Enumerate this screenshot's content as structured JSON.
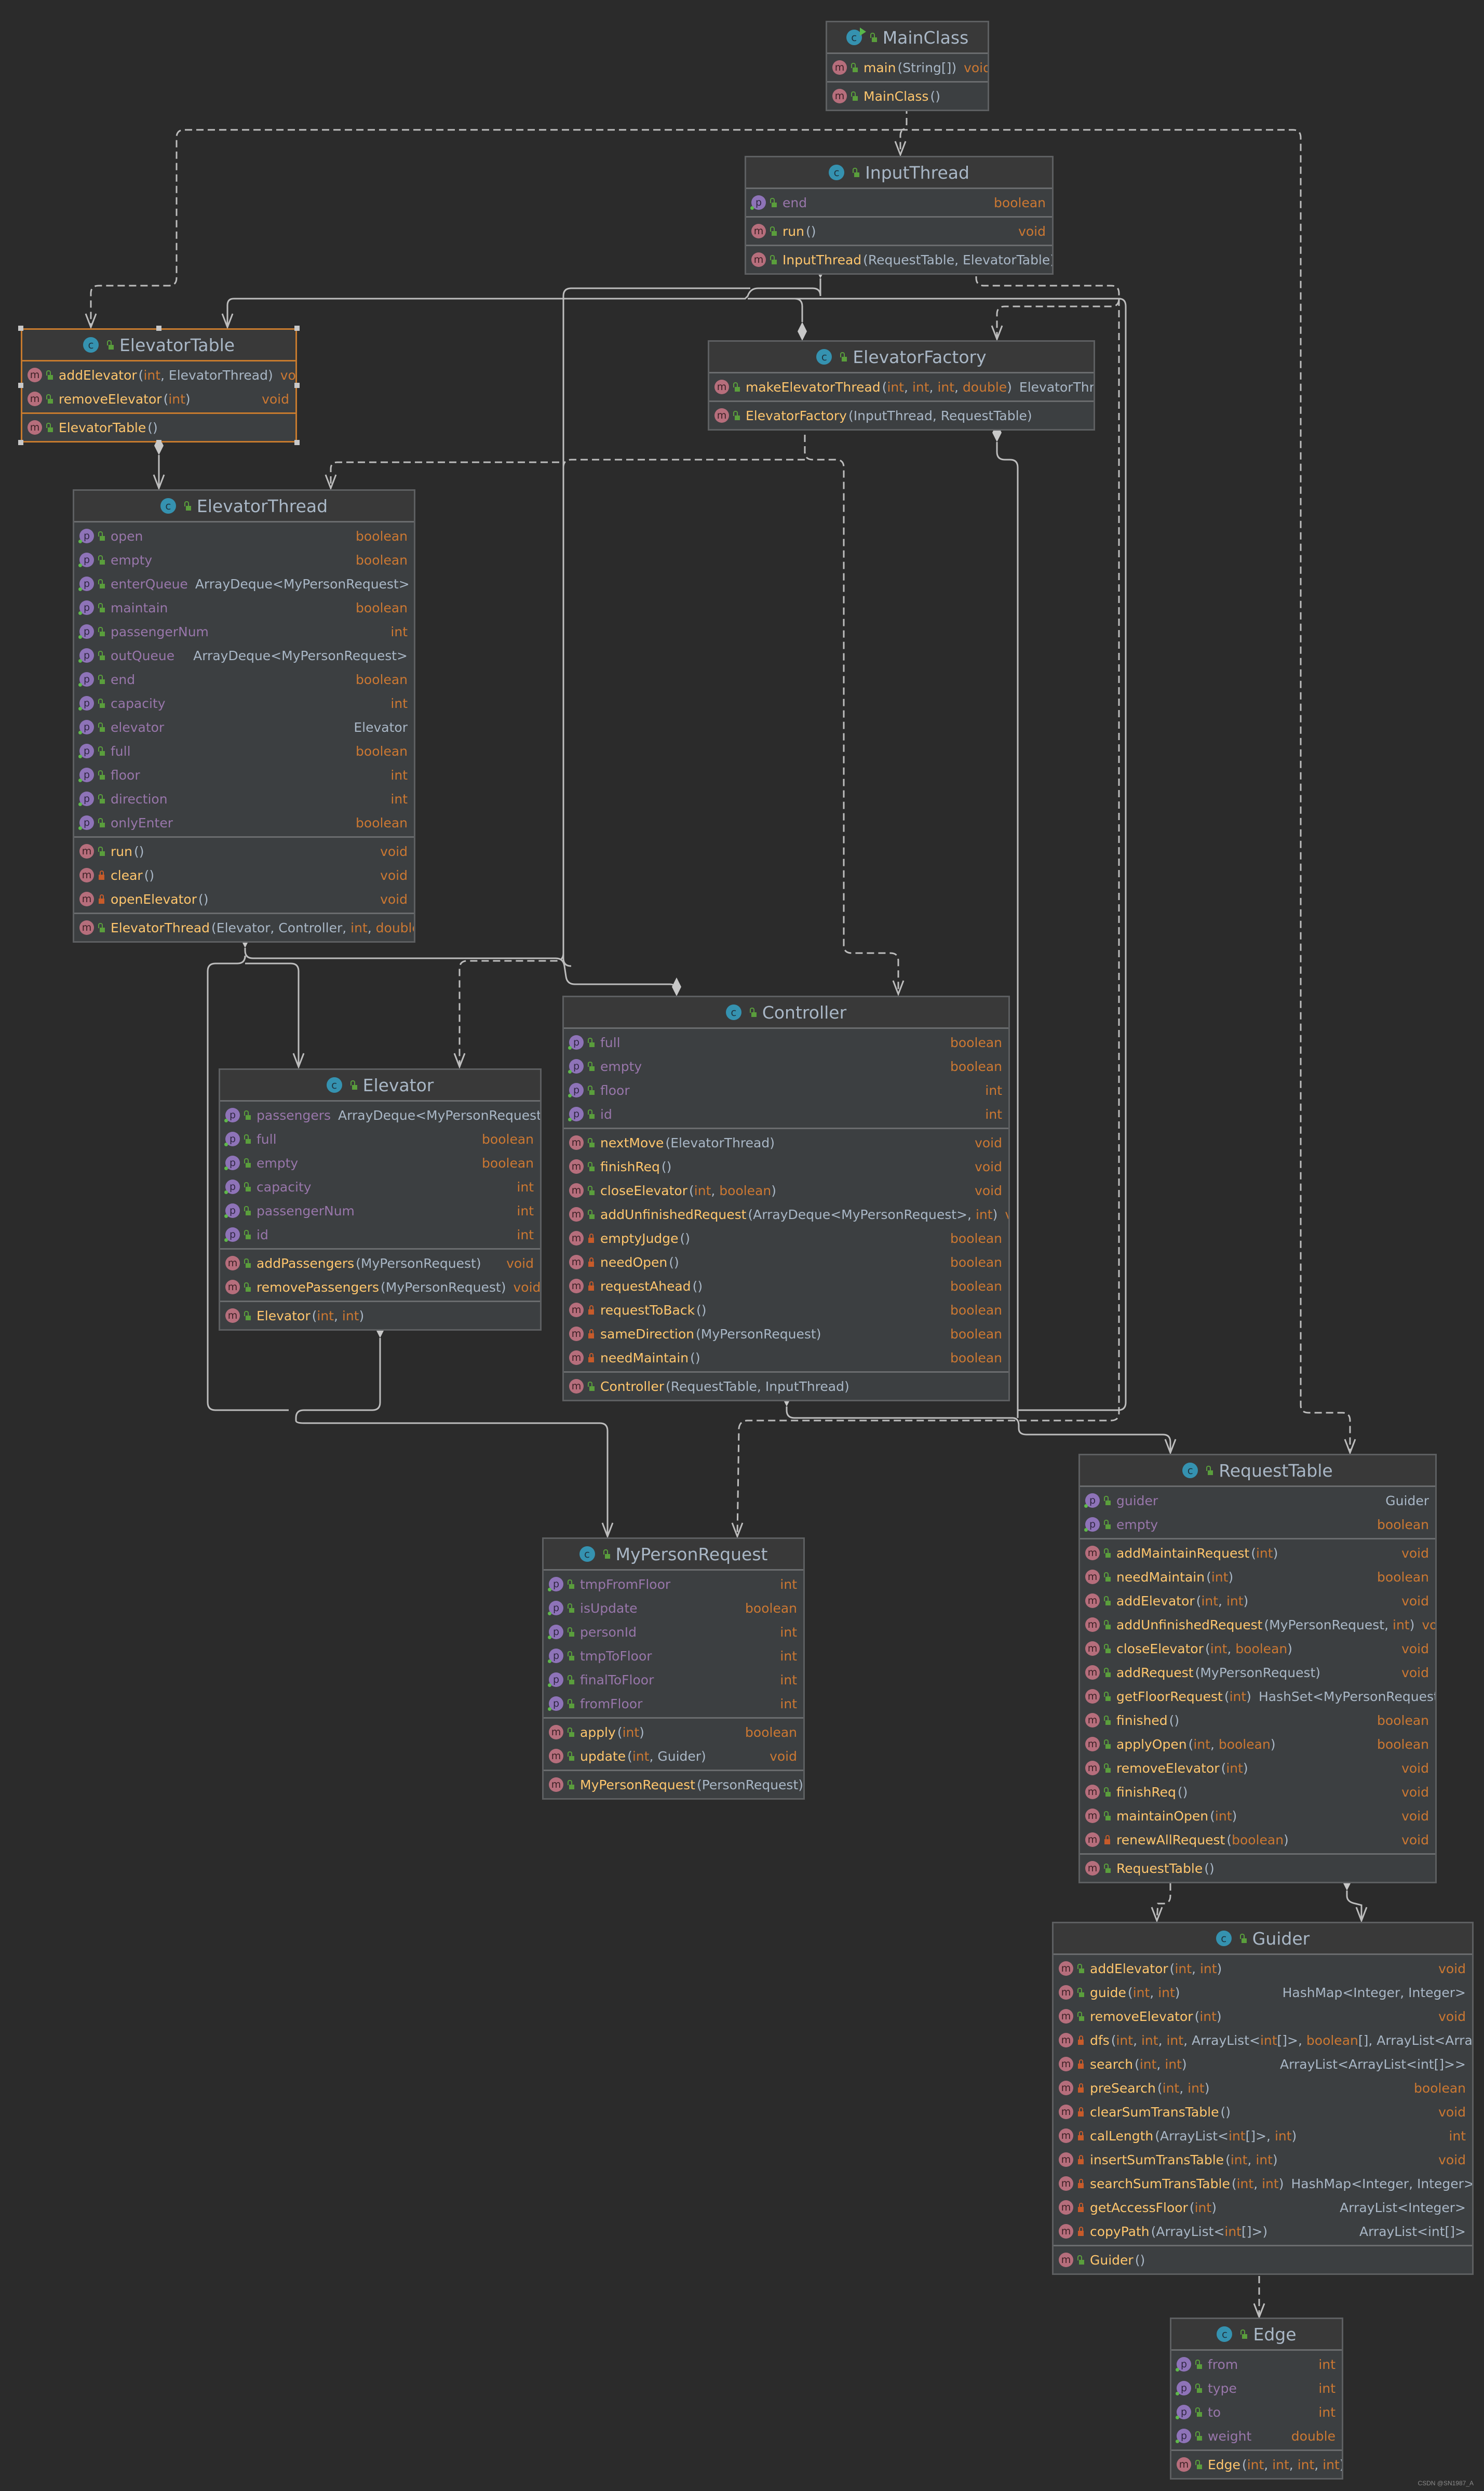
{
  "diagram": {
    "watermark": "CSDN @SN1987_A",
    "colors": {
      "background": "#2b2b2b",
      "box": "#3c3f41",
      "class_name": "#a9b7c6",
      "field": "#9876aa",
      "method": "#ffc66d",
      "primitive": "#cc7832",
      "selection": "#c67a2e"
    },
    "classes": [
      {
        "id": "MainClass",
        "name": "MainClass",
        "kind": "class-main",
        "fields": [],
        "methods": [
          {
            "name": "main",
            "params": "(String[])",
            "type": "void",
            "visibility": "public"
          }
        ],
        "constructors": [
          {
            "name": "MainClass",
            "params": "()",
            "visibility": "public"
          }
        ]
      },
      {
        "id": "InputThread",
        "name": "InputThread",
        "kind": "class",
        "fields": [
          {
            "name": "end",
            "type": "boolean",
            "visibility": "public"
          }
        ],
        "methods": [
          {
            "name": "run",
            "params": "()",
            "type": "void",
            "visibility": "public"
          }
        ],
        "constructors": [
          {
            "name": "InputThread",
            "params": "(RequestTable, ElevatorTable)",
            "visibility": "public"
          }
        ]
      },
      {
        "id": "ElevatorTable",
        "name": "ElevatorTable",
        "kind": "class",
        "selected": true,
        "fields": [],
        "methods": [
          {
            "name": "addElevator",
            "params": "(int, ElevatorThread)",
            "type": "void",
            "visibility": "public"
          },
          {
            "name": "removeElevator",
            "params": "(int)",
            "type": "void",
            "visibility": "public"
          }
        ],
        "constructors": [
          {
            "name": "ElevatorTable",
            "params": "()",
            "visibility": "public"
          }
        ]
      },
      {
        "id": "ElevatorFactory",
        "name": "ElevatorFactory",
        "kind": "class",
        "fields": [],
        "methods": [
          {
            "name": "makeElevatorThread",
            "params": "(int, int, int, double)",
            "type": "ElevatorThread",
            "visibility": "public"
          }
        ],
        "constructors": [
          {
            "name": "ElevatorFactory",
            "params": "(InputThread, RequestTable)",
            "visibility": "public"
          }
        ]
      },
      {
        "id": "ElevatorThread",
        "name": "ElevatorThread",
        "kind": "class",
        "fields": [
          {
            "name": "open",
            "type": "boolean",
            "visibility": "public"
          },
          {
            "name": "empty",
            "type": "boolean",
            "visibility": "public"
          },
          {
            "name": "enterQueue",
            "type": "ArrayDeque<MyPersonRequest>",
            "visibility": "public"
          },
          {
            "name": "maintain",
            "type": "boolean",
            "visibility": "public"
          },
          {
            "name": "passengerNum",
            "type": "int",
            "visibility": "public"
          },
          {
            "name": "outQueue",
            "type": "ArrayDeque<MyPersonRequest>",
            "visibility": "public"
          },
          {
            "name": "end",
            "type": "boolean",
            "visibility": "public"
          },
          {
            "name": "capacity",
            "type": "int",
            "visibility": "public"
          },
          {
            "name": "elevator",
            "type": "Elevator",
            "visibility": "public"
          },
          {
            "name": "full",
            "type": "boolean",
            "visibility": "public"
          },
          {
            "name": "floor",
            "type": "int",
            "visibility": "public"
          },
          {
            "name": "direction",
            "type": "int",
            "visibility": "public"
          },
          {
            "name": "onlyEnter",
            "type": "boolean",
            "visibility": "public"
          }
        ],
        "methods": [
          {
            "name": "run",
            "params": "()",
            "type": "void",
            "visibility": "public"
          },
          {
            "name": "clear",
            "params": "()",
            "type": "void",
            "visibility": "private"
          },
          {
            "name": "openElevator",
            "params": "()",
            "type": "void",
            "visibility": "private"
          }
        ],
        "constructors": [
          {
            "name": "ElevatorThread",
            "params": "(Elevator, Controller, int, double)",
            "visibility": "public"
          }
        ]
      },
      {
        "id": "Controller",
        "name": "Controller",
        "kind": "class",
        "fields": [
          {
            "name": "full",
            "type": "boolean",
            "visibility": "public"
          },
          {
            "name": "empty",
            "type": "boolean",
            "visibility": "public"
          },
          {
            "name": "floor",
            "type": "int",
            "visibility": "public"
          },
          {
            "name": "id",
            "type": "int",
            "visibility": "public"
          }
        ],
        "methods": [
          {
            "name": "nextMove",
            "params": "(ElevatorThread)",
            "type": "void",
            "visibility": "public"
          },
          {
            "name": "finishReq",
            "params": "()",
            "type": "void",
            "visibility": "public"
          },
          {
            "name": "closeElevator",
            "params": "(int, boolean)",
            "type": "void",
            "visibility": "public"
          },
          {
            "name": "addUnfinishedRequest",
            "params": "(ArrayDeque<MyPersonRequest>, int)",
            "type": "void",
            "visibility": "public"
          },
          {
            "name": "emptyJudge",
            "params": "()",
            "type": "boolean",
            "visibility": "private"
          },
          {
            "name": "needOpen",
            "params": "()",
            "type": "boolean",
            "visibility": "private"
          },
          {
            "name": "requestAhead",
            "params": "()",
            "type": "boolean",
            "visibility": "private"
          },
          {
            "name": "requestToBack",
            "params": "()",
            "type": "boolean",
            "visibility": "private"
          },
          {
            "name": "sameDirection",
            "params": "(MyPersonRequest)",
            "type": "boolean",
            "visibility": "private"
          },
          {
            "name": "needMaintain",
            "params": "()",
            "type": "boolean",
            "visibility": "private"
          }
        ],
        "constructors": [
          {
            "name": "Controller",
            "params": "(RequestTable, InputThread)",
            "visibility": "public"
          }
        ]
      },
      {
        "id": "Elevator",
        "name": "Elevator",
        "kind": "class",
        "fields": [
          {
            "name": "passengers",
            "type": "ArrayDeque<MyPersonRequest>",
            "visibility": "public"
          },
          {
            "name": "full",
            "type": "boolean",
            "visibility": "public"
          },
          {
            "name": "empty",
            "type": "boolean",
            "visibility": "public"
          },
          {
            "name": "capacity",
            "type": "int",
            "visibility": "public"
          },
          {
            "name": "passengerNum",
            "type": "int",
            "visibility": "public"
          },
          {
            "name": "id",
            "type": "int",
            "visibility": "public"
          }
        ],
        "methods": [
          {
            "name": "addPassengers",
            "params": "(MyPersonRequest)",
            "type": "void",
            "visibility": "public"
          },
          {
            "name": "removePassengers",
            "params": "(MyPersonRequest)",
            "type": "void",
            "visibility": "public"
          }
        ],
        "constructors": [
          {
            "name": "Elevator",
            "params": "(int, int)",
            "visibility": "public"
          }
        ]
      },
      {
        "id": "MyPersonRequest",
        "name": "MyPersonRequest",
        "kind": "class",
        "fields": [
          {
            "name": "tmpFromFloor",
            "type": "int",
            "visibility": "public"
          },
          {
            "name": "isUpdate",
            "type": "boolean",
            "visibility": "public"
          },
          {
            "name": "personId",
            "type": "int",
            "visibility": "public"
          },
          {
            "name": "tmpToFloor",
            "type": "int",
            "visibility": "public"
          },
          {
            "name": "finalToFloor",
            "type": "int",
            "visibility": "public"
          },
          {
            "name": "fromFloor",
            "type": "int",
            "visibility": "public"
          }
        ],
        "methods": [
          {
            "name": "apply",
            "params": "(int)",
            "type": "boolean",
            "visibility": "public"
          },
          {
            "name": "update",
            "params": "(int, Guider)",
            "type": "void",
            "visibility": "public"
          }
        ],
        "constructors": [
          {
            "name": "MyPersonRequest",
            "params": "(PersonRequest)",
            "visibility": "public"
          }
        ]
      },
      {
        "id": "RequestTable",
        "name": "RequestTable",
        "kind": "class",
        "fields": [
          {
            "name": "guider",
            "type": "Guider",
            "visibility": "public"
          },
          {
            "name": "empty",
            "type": "boolean",
            "visibility": "public"
          }
        ],
        "methods": [
          {
            "name": "addMaintainRequest",
            "params": "(int)",
            "type": "void",
            "visibility": "public"
          },
          {
            "name": "needMaintain",
            "params": "(int)",
            "type": "boolean",
            "visibility": "public"
          },
          {
            "name": "addElevator",
            "params": "(int, int)",
            "type": "void",
            "visibility": "public"
          },
          {
            "name": "addUnfinishedRequest",
            "params": "(MyPersonRequest, int)",
            "type": "void",
            "visibility": "public"
          },
          {
            "name": "closeElevator",
            "params": "(int, boolean)",
            "type": "void",
            "visibility": "public"
          },
          {
            "name": "addRequest",
            "params": "(MyPersonRequest)",
            "type": "void",
            "visibility": "public"
          },
          {
            "name": "getFloorRequest",
            "params": "(int)",
            "type": "HashSet<MyPersonRequest>",
            "visibility": "public"
          },
          {
            "name": "finished",
            "params": "()",
            "type": "boolean",
            "visibility": "public"
          },
          {
            "name": "applyOpen",
            "params": "(int, boolean)",
            "type": "boolean",
            "visibility": "public"
          },
          {
            "name": "removeElevator",
            "params": "(int)",
            "type": "void",
            "visibility": "public"
          },
          {
            "name": "finishReq",
            "params": "()",
            "type": "void",
            "visibility": "public"
          },
          {
            "name": "maintainOpen",
            "params": "(int)",
            "type": "void",
            "visibility": "public"
          },
          {
            "name": "renewAllRequest",
            "params": "(boolean)",
            "type": "void",
            "visibility": "private"
          }
        ],
        "constructors": [
          {
            "name": "RequestTable",
            "params": "()",
            "visibility": "public"
          }
        ]
      },
      {
        "id": "Guider",
        "name": "Guider",
        "kind": "class",
        "fields": [],
        "methods": [
          {
            "name": "addElevator",
            "params": "(int, int)",
            "type": "void",
            "visibility": "public"
          },
          {
            "name": "guide",
            "params": "(int, int)",
            "type": "HashMap<Integer, Integer>",
            "visibility": "public"
          },
          {
            "name": "removeElevator",
            "params": "(int)",
            "type": "void",
            "visibility": "public"
          },
          {
            "name": "dfs",
            "params": "(int, int, int, ArrayList<int[]>, boolean[], ArrayList<ArrayLis",
            "type": "",
            "visibility": "private"
          },
          {
            "name": "search",
            "params": "(int, int)",
            "type": "ArrayList<ArrayList<int[]>>",
            "visibility": "private"
          },
          {
            "name": "preSearch",
            "params": "(int, int)",
            "type": "boolean",
            "visibility": "private"
          },
          {
            "name": "clearSumTransTable",
            "params": "()",
            "type": "void",
            "visibility": "private"
          },
          {
            "name": "calLength",
            "params": "(ArrayList<int[]>, int)",
            "type": "int",
            "visibility": "private"
          },
          {
            "name": "insertSumTransTable",
            "params": "(int, int)",
            "type": "void",
            "visibility": "private"
          },
          {
            "name": "searchSumTransTable",
            "params": "(int, int)",
            "type": "HashMap<Integer, Integer>?",
            "visibility": "private"
          },
          {
            "name": "getAccessFloor",
            "params": "(int)",
            "type": "ArrayList<Integer>",
            "visibility": "private"
          },
          {
            "name": "copyPath",
            "params": "(ArrayList<int[]>)",
            "type": "ArrayList<int[]>",
            "visibility": "private"
          }
        ],
        "constructors": [
          {
            "name": "Guider",
            "params": "()",
            "visibility": "public"
          }
        ]
      },
      {
        "id": "Edge",
        "name": "Edge",
        "kind": "class",
        "fields": [
          {
            "name": "from",
            "type": "int",
            "visibility": "public"
          },
          {
            "name": "type",
            "type": "int",
            "visibility": "public"
          },
          {
            "name": "to",
            "type": "int",
            "visibility": "public"
          },
          {
            "name": "weight",
            "type": "double",
            "visibility": "public"
          }
        ],
        "methods": [],
        "constructors": [
          {
            "name": "Edge",
            "params": "(int, int, int, int)",
            "visibility": "public"
          }
        ]
      }
    ],
    "relations": [
      {
        "from": "MainClass",
        "to": "InputThread",
        "kind": "dependency"
      },
      {
        "from": "MainClass",
        "to": "ElevatorTable",
        "kind": "dependency"
      },
      {
        "from": "MainClass",
        "to": "RequestTable",
        "kind": "dependency"
      },
      {
        "from": "InputThread",
        "to": "ElevatorTable",
        "kind": "composition"
      },
      {
        "from": "InputThread",
        "to": "ElevatorFactory",
        "kind": "composition"
      },
      {
        "from": "InputThread",
        "to": "ElevatorFactory",
        "kind": "dependency"
      },
      {
        "from": "InputThread",
        "to": "RequestTable",
        "kind": "composition"
      },
      {
        "from": "InputThread",
        "to": "MyPersonRequest",
        "kind": "dependency"
      },
      {
        "from": "ElevatorTable",
        "to": "ElevatorThread",
        "kind": "composition"
      },
      {
        "from": "ElevatorFactory",
        "to": "ElevatorThread",
        "kind": "dependency"
      },
      {
        "from": "ElevatorFactory",
        "to": "Elevator",
        "kind": "dependency"
      },
      {
        "from": "ElevatorFactory",
        "to": "Controller",
        "kind": "dependency"
      },
      {
        "from": "ElevatorFactory",
        "to": "RequestTable",
        "kind": "composition"
      },
      {
        "from": "ElevatorThread",
        "to": "Elevator",
        "kind": "composition"
      },
      {
        "from": "ElevatorThread",
        "to": "Controller",
        "kind": "composition"
      },
      {
        "from": "ElevatorThread",
        "to": "MyPersonRequest",
        "kind": "composition"
      },
      {
        "from": "Elevator",
        "to": "MyPersonRequest",
        "kind": "composition"
      },
      {
        "from": "Controller",
        "to": "RequestTable",
        "kind": "composition"
      },
      {
        "from": "RequestTable",
        "to": "Guider",
        "kind": "composition"
      },
      {
        "from": "RequestTable",
        "to": "Guider",
        "kind": "dependency"
      },
      {
        "from": "Guider",
        "to": "Edge",
        "kind": "dependency"
      }
    ]
  }
}
